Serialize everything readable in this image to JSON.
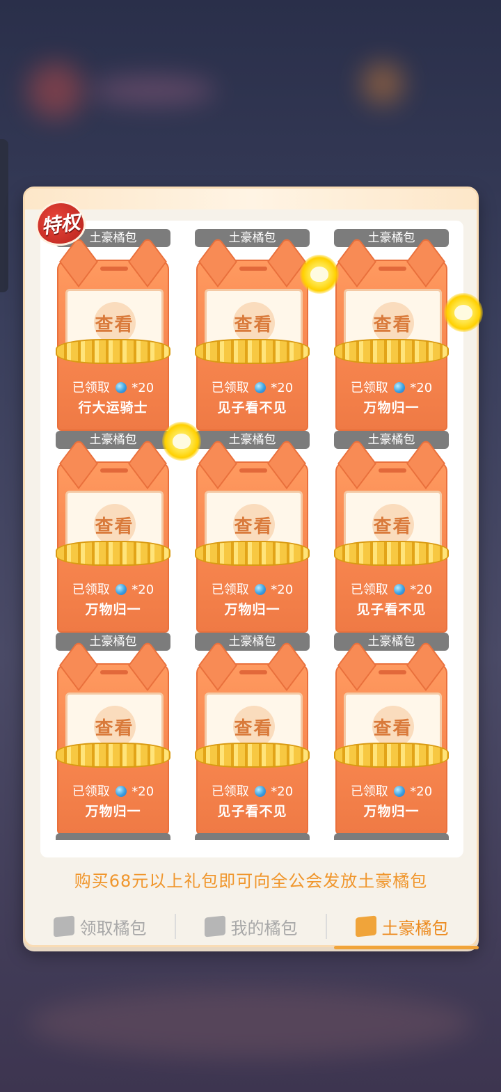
{
  "panel": {
    "badge": "特权",
    "cards": [
      {
        "label": "土豪橘包",
        "view": "查看",
        "claimed": "已领取",
        "amount": "*20",
        "sender": "行大运骑士"
      },
      {
        "label": "土豪橘包",
        "view": "查看",
        "claimed": "已领取",
        "amount": "*20",
        "sender": "见子看不见"
      },
      {
        "label": "土豪橘包",
        "view": "查看",
        "claimed": "已领取",
        "amount": "*20",
        "sender": "万物归一"
      },
      {
        "label": "土豪橘包",
        "view": "查看",
        "claimed": "已领取",
        "amount": "*20",
        "sender": "万物归一"
      },
      {
        "label": "土豪橘包",
        "view": "查看",
        "claimed": "已领取",
        "amount": "*20",
        "sender": "万物归一"
      },
      {
        "label": "土豪橘包",
        "view": "查看",
        "claimed": "已领取",
        "amount": "*20",
        "sender": "见子看不见"
      },
      {
        "label": "土豪橘包",
        "view": "查看",
        "claimed": "已领取",
        "amount": "*20",
        "sender": "万物归一"
      },
      {
        "label": "土豪橘包",
        "view": "查看",
        "claimed": "已领取",
        "amount": "*20",
        "sender": "见子看不见"
      },
      {
        "label": "土豪橘包",
        "view": "查看",
        "claimed": "已领取",
        "amount": "*20",
        "sender": "万物归一"
      }
    ],
    "promo": "购买68元以上礼包即可向全公会发放土豪橘包",
    "tabs": [
      {
        "label": "领取橘包",
        "active": false,
        "icon": "receive-bag-icon"
      },
      {
        "label": "我的橘包",
        "active": false,
        "icon": "my-bag-icon"
      },
      {
        "label": "土豪橘包",
        "active": true,
        "icon": "rich-bag-icon"
      }
    ]
  },
  "colors": {
    "accent": "#ec8a1e",
    "card": "#f6844d",
    "label_bg": "#7c7c7c"
  }
}
